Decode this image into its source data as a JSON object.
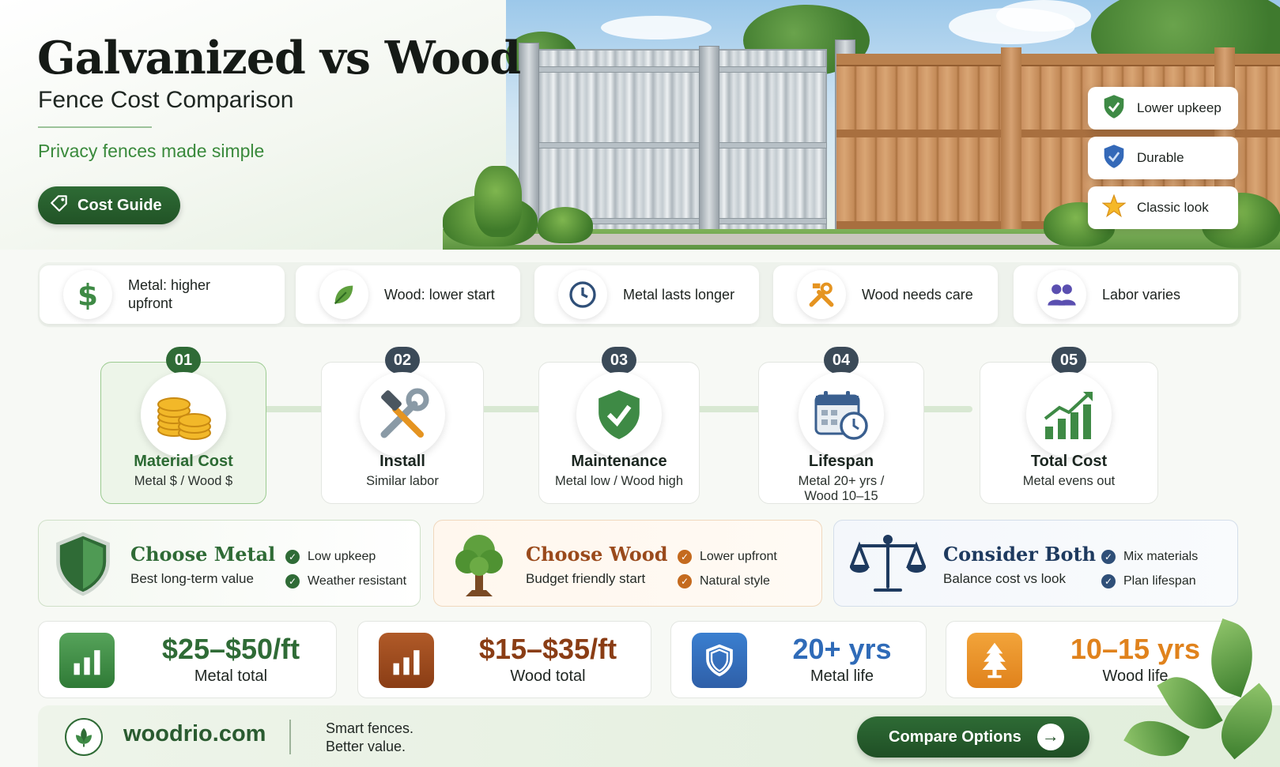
{
  "hero": {
    "title": "Galvanized vs Wood",
    "subtitle": "Fence Cost Comparison",
    "tagline": "Privacy fences made simple",
    "guide_button": "Cost Guide",
    "badges": [
      {
        "icon": "check-shield-icon",
        "label": "Lower upkeep"
      },
      {
        "icon": "shield-icon",
        "label": "Durable"
      },
      {
        "icon": "star-icon",
        "label": "Classic look"
      }
    ]
  },
  "facts": [
    {
      "icon": "dollar-icon",
      "text_line1": "Metal: higher",
      "text_line2": "upfront"
    },
    {
      "icon": "leaf-icon",
      "text_line1": "Wood: lower start",
      "text_line2": ""
    },
    {
      "icon": "clock-icon",
      "text_line1": "Metal lasts longer",
      "text_line2": ""
    },
    {
      "icon": "tools-icon",
      "text_line1": "Wood needs care",
      "text_line2": ""
    },
    {
      "icon": "people-icon",
      "text_line1": "Labor varies",
      "text_line2": ""
    }
  ],
  "steps": [
    {
      "num": "01",
      "icon": "coins-icon",
      "title": "Material Cost",
      "desc": "Metal $ / Wood $",
      "desc2": ""
    },
    {
      "num": "02",
      "icon": "wrench-hammer-icon",
      "title": "Install",
      "desc": "Similar labor",
      "desc2": ""
    },
    {
      "num": "03",
      "icon": "check-shield-icon",
      "title": "Maintenance",
      "desc": "Metal low / Wood high",
      "desc2": ""
    },
    {
      "num": "04",
      "icon": "calendar-clock-icon",
      "title": "Lifespan",
      "desc": "Metal 20+ yrs /",
      "desc2": "Wood 10–15"
    },
    {
      "num": "05",
      "icon": "growth-chart-icon",
      "title": "Total Cost",
      "desc": "Metal evens out",
      "desc2": ""
    }
  ],
  "choices": [
    {
      "title": "Choose Metal",
      "sub": "Best long-term value",
      "checks": [
        "Low upkeep",
        "Weather resistant"
      ],
      "color": "#2f6b36"
    },
    {
      "title": "Choose Wood",
      "sub": "Budget friendly start",
      "checks": [
        "Lower upfront",
        "Natural style"
      ],
      "color": "#9a4a1c"
    },
    {
      "title": "Consider Both",
      "sub": "Balance cost vs look",
      "checks": [
        "Mix materials",
        "Plan lifespan"
      ],
      "color": "#1e3a5f"
    }
  ],
  "stats": [
    {
      "value": "$25–$50/ft",
      "label": "Metal total",
      "color": "#2f6b36"
    },
    {
      "value": "$15–$35/ft",
      "label": "Wood total",
      "color": "#8a3d15"
    },
    {
      "value": "20+ yrs",
      "label": "Metal life",
      "color": "#2f6bb8"
    },
    {
      "value": "10–15 yrs",
      "label": "Wood life",
      "color": "#e0821c"
    }
  ],
  "footer": {
    "site": "woodrio.com",
    "tag_line1": "Smart fences.",
    "tag_line2": "Better value.",
    "compare_button": "Compare Options"
  }
}
